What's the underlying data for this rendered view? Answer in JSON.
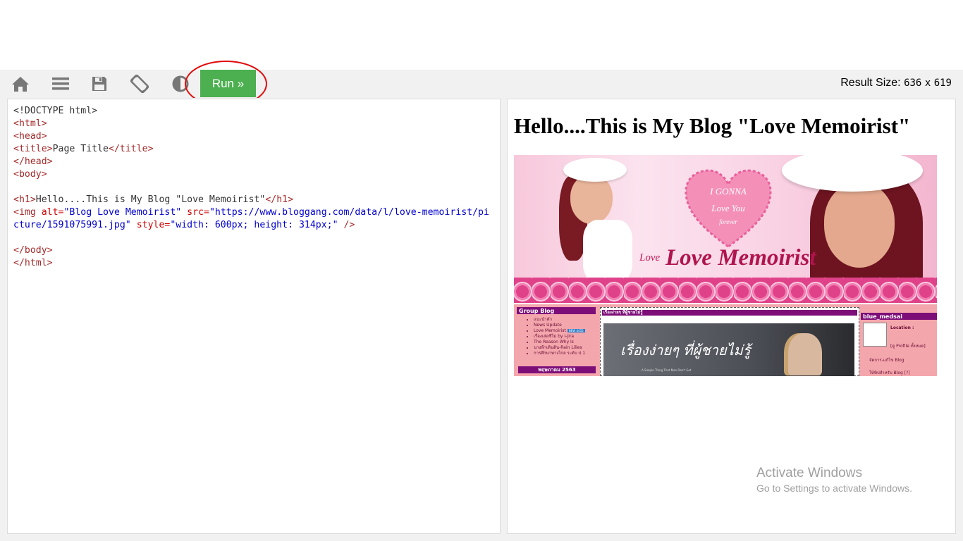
{
  "toolbar": {
    "icons": [
      "home-icon",
      "menu-icon",
      "save-icon",
      "rotate-icon",
      "theme-icon"
    ],
    "run_label": "Run »",
    "result_size_label": "Result Size:",
    "result_width": "636",
    "result_x": "x",
    "result_height": "619"
  },
  "editor": {
    "lines": [
      "<!DOCTYPE html>",
      "<html>",
      "<head>",
      "<title>Page Title</title>",
      "</head>",
      "<body>",
      "",
      "<h1>Hello....This is My Blog \"Love Memoirist\"</h1>",
      "<img alt=\"Blog Love Memoirist\" src=\"https://www.bloggang.com/data/l/love-memoirist/picture/1591075991.jpg\" style=\"width: 600px; height: 314px;\" />",
      "",
      "</body>",
      "</html>"
    ]
  },
  "result": {
    "heading": "Hello....This is My Blog \"Love Memoirist\"",
    "image": {
      "alt": "Blog Love Memoirist",
      "banner_title": "Love Memoirist",
      "banner_small": "Love",
      "heart_text": [
        "I GONNA",
        "Love You",
        "forever"
      ],
      "group_blog_header": "Group Blog",
      "group_blog_items": [
        "แนะนำตัว",
        "News Update",
        "Love Memoirist",
        "เรื่องเล่อชีไม่ by i-Jira",
        "The Reason Why Is",
        "นางฟ้าเดินดิน-Rain Lilies",
        "การศึกษาทางไกล ระดับ ป.1"
      ],
      "new_badge": "NEW 4455",
      "month_label": "พฤษภาคม 2563",
      "mid_header": "เรื่องง่ายๆ ที่ผู้ชายไม่รู้",
      "mid_title": "เรื่องง่ายๆ ที่ผู้ชายไม่รู้",
      "mid_subtitle": "A Simple Thing That Men Don't Get",
      "profile_name": "blue_medsai",
      "location_label": "Location :",
      "profile_link": "[ดู Profile ทั้งหมด]",
      "manage_blog": "จัดการ-แก้ไข Blog",
      "invite_blog": "ให้ทิปสำหรับ Blog [?]"
    }
  },
  "watermark": {
    "line1": "Activate Windows",
    "line2": "Go to Settings to activate Windows."
  }
}
